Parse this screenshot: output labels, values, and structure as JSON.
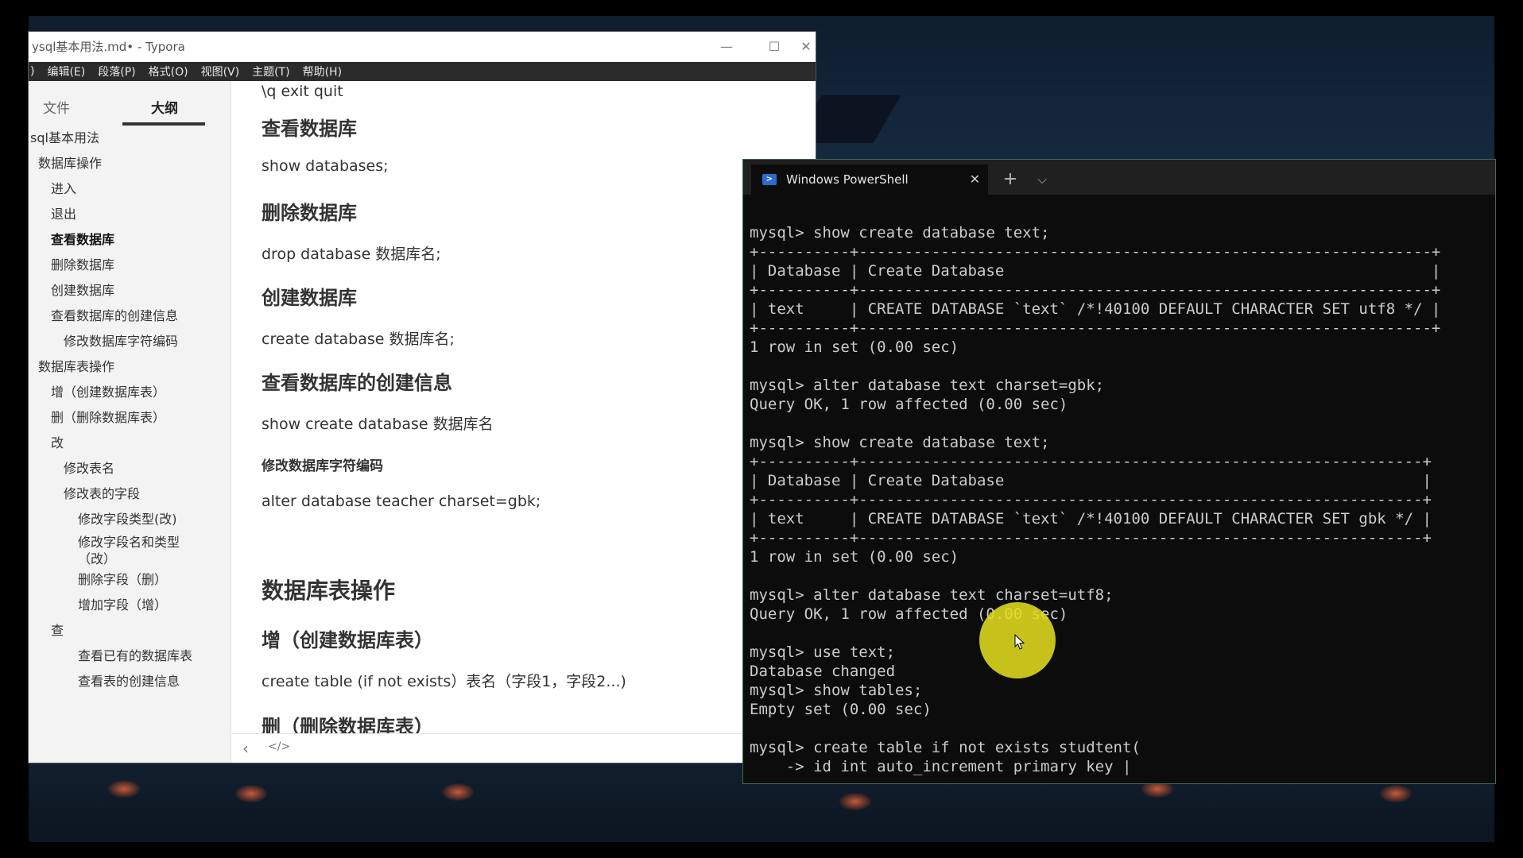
{
  "typora": {
    "title": "ysql基本用法.md• - Typora",
    "window_buttons": {
      "minimize": "—",
      "maximize": "☐",
      "close": "✕"
    },
    "menu": [
      ")",
      "编辑(E)",
      "段落(P)",
      "格式(O)",
      "视图(V)",
      "主题(T)",
      "帮助(H)"
    ],
    "sidebar_tabs": {
      "files": "文件",
      "outline": "大纲"
    },
    "outline": [
      {
        "label": "sql基本用法",
        "level": 0
      },
      {
        "label": "数据库操作",
        "level": 1
      },
      {
        "label": "进入",
        "level": 2
      },
      {
        "label": "退出",
        "level": 2
      },
      {
        "label": "查看数据库",
        "level": 2,
        "active": true
      },
      {
        "label": "删除数据库",
        "level": 2
      },
      {
        "label": "创建数据库",
        "level": 2
      },
      {
        "label": "查看数据库的创建信息",
        "level": 2
      },
      {
        "label": "修改数据库字符编码",
        "level": 3
      },
      {
        "label": "数据库表操作",
        "level": 1
      },
      {
        "label": "增（创建数据库表）",
        "level": 2
      },
      {
        "label": "删（删除数据库表）",
        "level": 2
      },
      {
        "label": "改",
        "level": 2
      },
      {
        "label": "修改表名",
        "level": 3
      },
      {
        "label": "修改表的字段",
        "level": 3
      },
      {
        "label": "修改字段类型(改)",
        "level": 4
      },
      {
        "label": "修改字段名和类型（改）",
        "level": 4
      },
      {
        "label": "删除字段（删）",
        "level": 4
      },
      {
        "label": "增加字段（增）",
        "level": 4
      },
      {
        "label": "查",
        "level": 2
      },
      {
        "label": "查看已有的数据库表",
        "level": 4
      },
      {
        "label": "查看表的创建信息",
        "level": 4
      }
    ],
    "editor": {
      "b0": "\\q   exit  quit",
      "b1": "查看数据库",
      "b2": "show   databases;",
      "b3": "删除数据库",
      "b4": "drop database  数据库名;",
      "b5": "创建数据库",
      "b6": "create database  数据库名;",
      "b7": "查看数据库的创建信息",
      "b8": "show  create  database  数据库名",
      "b9": "修改数据库字符编码",
      "b10": "alter database teacher charset=gbk;",
      "b11": "数据库表操作",
      "b12": "增（创建数据库表）",
      "b13": "create  table   (if not exists）表名（字段1，字段2...)",
      "b14": "删（删除数据库表）"
    },
    "status": {
      "back": "‹",
      "source": "</>"
    }
  },
  "powershell": {
    "tab_title": "Windows PowerShell",
    "tab_close": "✕",
    "new_tab": "+",
    "dropdown": "⌵",
    "lines": [
      "mysql> show create database text;",
      "+----------+---------------------------------------------------------------+",
      "| Database | Create Database                                               |",
      "+----------+---------------------------------------------------------------+",
      "| text     | CREATE DATABASE `text` /*!40100 DEFAULT CHARACTER SET utf8 */ |",
      "+----------+---------------------------------------------------------------+",
      "1 row in set (0.00 sec)",
      "",
      "mysql> alter database text charset=gbk;",
      "Query OK, 1 row affected (0.00 sec)",
      "",
      "mysql> show create database text;",
      "+----------+--------------------------------------------------------------+",
      "| Database | Create Database                                              |",
      "+----------+--------------------------------------------------------------+",
      "| text     | CREATE DATABASE `text` /*!40100 DEFAULT CHARACTER SET gbk */ |",
      "+----------+--------------------------------------------------------------+",
      "1 row in set (0.00 sec)",
      "",
      "mysql> alter database text charset=utf8;",
      "Query OK, 1 row affected (0.00 sec)",
      "",
      "mysql> use text;",
      "Database changed",
      "mysql> show tables;",
      "Empty set (0.00 sec)",
      "",
      "mysql> create table if not exists studtent(",
      "    -> id int auto_increment primary key |"
    ]
  },
  "colors": {
    "cursor_highlight": "#e0dc1e",
    "terminal_bg": "#0c0c0c",
    "terminal_fg": "#cccccc"
  }
}
